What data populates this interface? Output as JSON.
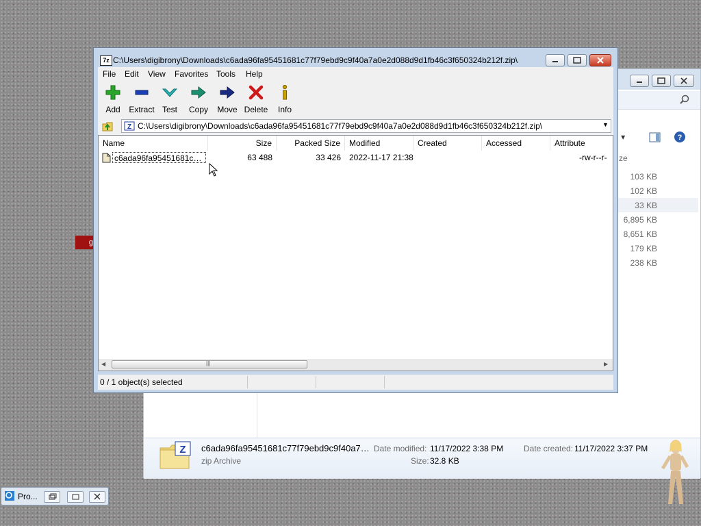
{
  "sevenzip": {
    "title": "C:\\Users\\digibrony\\Downloads\\c6ada96fa95451681c77f79ebd9c9f40a7a0e2d088d9d1fb46c3f650324b212f.zip\\",
    "app_icon_text": "7z",
    "menu": [
      "File",
      "Edit",
      "View",
      "Favorites",
      "Tools",
      "Help"
    ],
    "toolbar": {
      "add": "Add",
      "extract": "Extract",
      "test": "Test",
      "copy": "Copy",
      "move": "Move",
      "delete": "Delete",
      "info": "Info"
    },
    "address": "C:\\Users\\digibrony\\Downloads\\c6ada96fa95451681c77f79ebd9c9f40a7a0e2d088d9d1fb46c3f650324b212f.zip\\",
    "columns": [
      "Name",
      "Size",
      "Packed Size",
      "Modified",
      "Created",
      "Accessed",
      "Attribute"
    ],
    "rows": [
      {
        "name": "c6ada96fa95451681c77f...",
        "size": "63 488",
        "packed": "33 426",
        "modified": "2022-11-17 21:38",
        "created": "",
        "accessed": "",
        "attributes": "-rw-r--r-"
      }
    ],
    "status": "0 / 1 object(s) selected",
    "colors": {
      "add": "#2aa52a",
      "extract": "#1a3fb5",
      "test": "#2bb3b3",
      "copy": "#1d8f6e",
      "move": "#1a2a80",
      "delete": "#cc1a1a",
      "info": "#c9a100"
    }
  },
  "explorer": {
    "sizes": [
      "103 KB",
      "102 KB",
      "33 KB",
      "6,895 KB",
      "8,651 KB",
      "179 KB",
      "238 KB"
    ],
    "partial_col": "ze",
    "details": {
      "filename": "c6ada96fa95451681c77f79ebd9c9f40a7a...",
      "filetype": "zip Archive",
      "date_modified_label": "Date modified:",
      "date_modified": "11/17/2022 3:38 PM",
      "date_created_label": "Date created:",
      "date_created": "11/17/2022 3:37 PM",
      "size_label": "Size:",
      "size": "32.8 KB"
    },
    "zip_icon_text": "Z"
  },
  "taskbar": {
    "label": "Pro..."
  },
  "desktop": {
    "red_tile_text": "g"
  }
}
